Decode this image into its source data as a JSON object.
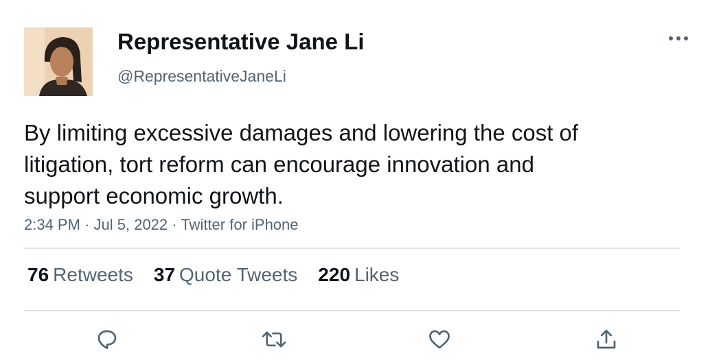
{
  "author": {
    "display_name": "Representative Jane Li",
    "handle": "@RepresentativeJaneLi",
    "avatar_icon": "profile-photo"
  },
  "tweet": {
    "lines": [
      "By limiting excessive damages and lowering the cost of",
      "litigation, tort reform can encourage innovation and",
      "support economic growth."
    ],
    "time": "2:34 PM",
    "date": "Jul 5, 2022",
    "source": "Twitter for iPhone"
  },
  "stats": {
    "retweets_count": "76",
    "retweets_label": "Retweets",
    "quotes_count": "37",
    "quotes_label": "Quote Tweets",
    "likes_count": "220",
    "likes_label": "Likes"
  },
  "actions": [
    "reply-icon",
    "retweet-icon",
    "like-icon",
    "share-icon"
  ],
  "more_icon": "more-options-icon",
  "colors": {
    "text": "#0f1419",
    "secondary": "#536471",
    "divider": "#e1e4e7"
  }
}
